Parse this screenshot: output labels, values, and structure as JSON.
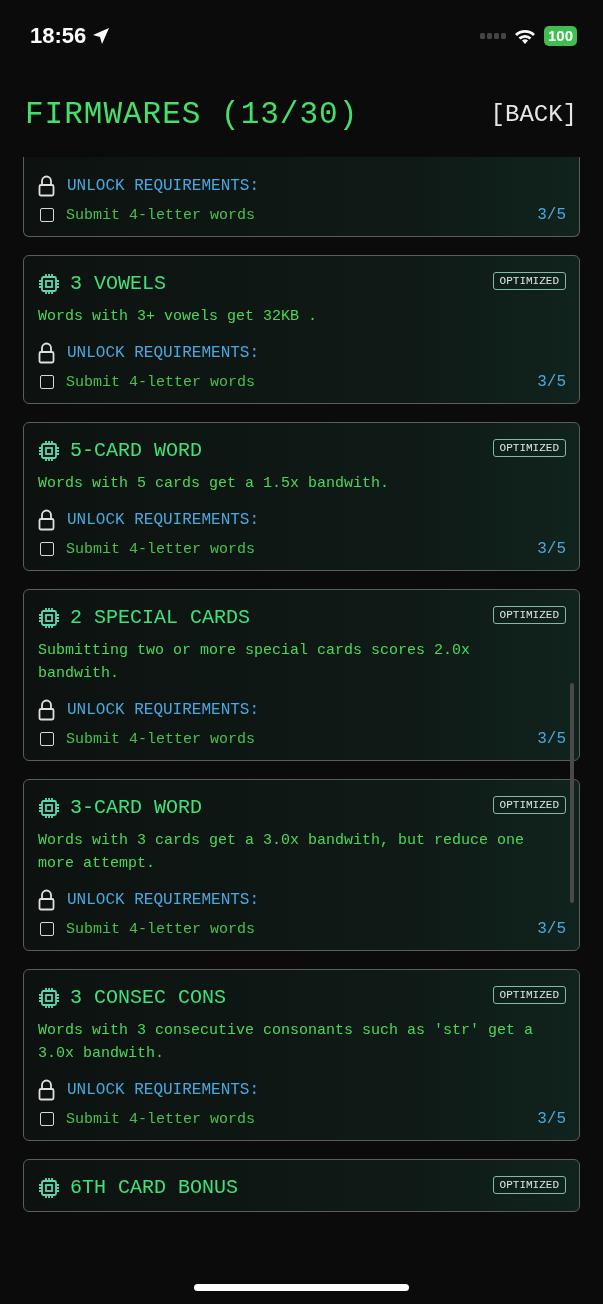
{
  "status_bar": {
    "time": "18:56",
    "battery": "100"
  },
  "header": {
    "title": "FIRMWARES (13/30)",
    "back": "[BACK]"
  },
  "firmwares": [
    {
      "requirements_label": "UNLOCK REQUIREMENTS:",
      "requirement": {
        "text": "Submit 4-letter words",
        "checked": false,
        "progress": "3/5"
      }
    },
    {
      "title": "3 VOWELS",
      "badge": "OPTIMIZED",
      "description": "Words with 3+ vowels get 32KB .",
      "requirements_label": "UNLOCK REQUIREMENTS:",
      "requirement": {
        "text": "Submit 4-letter words",
        "checked": false,
        "progress": "3/5"
      }
    },
    {
      "title": "5-CARD WORD",
      "badge": "OPTIMIZED",
      "description": "Words with 5 cards get a 1.5x bandwith.",
      "requirements_label": "UNLOCK REQUIREMENTS:",
      "requirement": {
        "text": "Submit 4-letter words",
        "checked": false,
        "progress": "3/5"
      }
    },
    {
      "title": "2 SPECIAL CARDS",
      "badge": "OPTIMIZED",
      "description": "Submitting two or more special cards scores 2.0x bandwith.",
      "requirements_label": "UNLOCK REQUIREMENTS:",
      "requirement": {
        "text": "Submit 4-letter words",
        "checked": false,
        "progress": "3/5"
      }
    },
    {
      "title": "3-CARD WORD",
      "badge": "OPTIMIZED",
      "description": "Words with 3 cards get a 3.0x bandwith, but reduce one more attempt.",
      "requirements_label": "UNLOCK REQUIREMENTS:",
      "requirement": {
        "text": "Submit 4-letter words",
        "checked": false,
        "progress": "3/5"
      }
    },
    {
      "title": "3 CONSEC CONS",
      "badge": "OPTIMIZED",
      "description": "Words with 3 consecutive consonants such as 'str' get a 3.0x bandwith.",
      "requirements_label": "UNLOCK REQUIREMENTS:",
      "requirement": {
        "text": "Submit 4-letter words",
        "checked": false,
        "progress": "3/5"
      }
    },
    {
      "title": "6TH CARD BONUS",
      "badge": "OPTIMIZED"
    }
  ]
}
